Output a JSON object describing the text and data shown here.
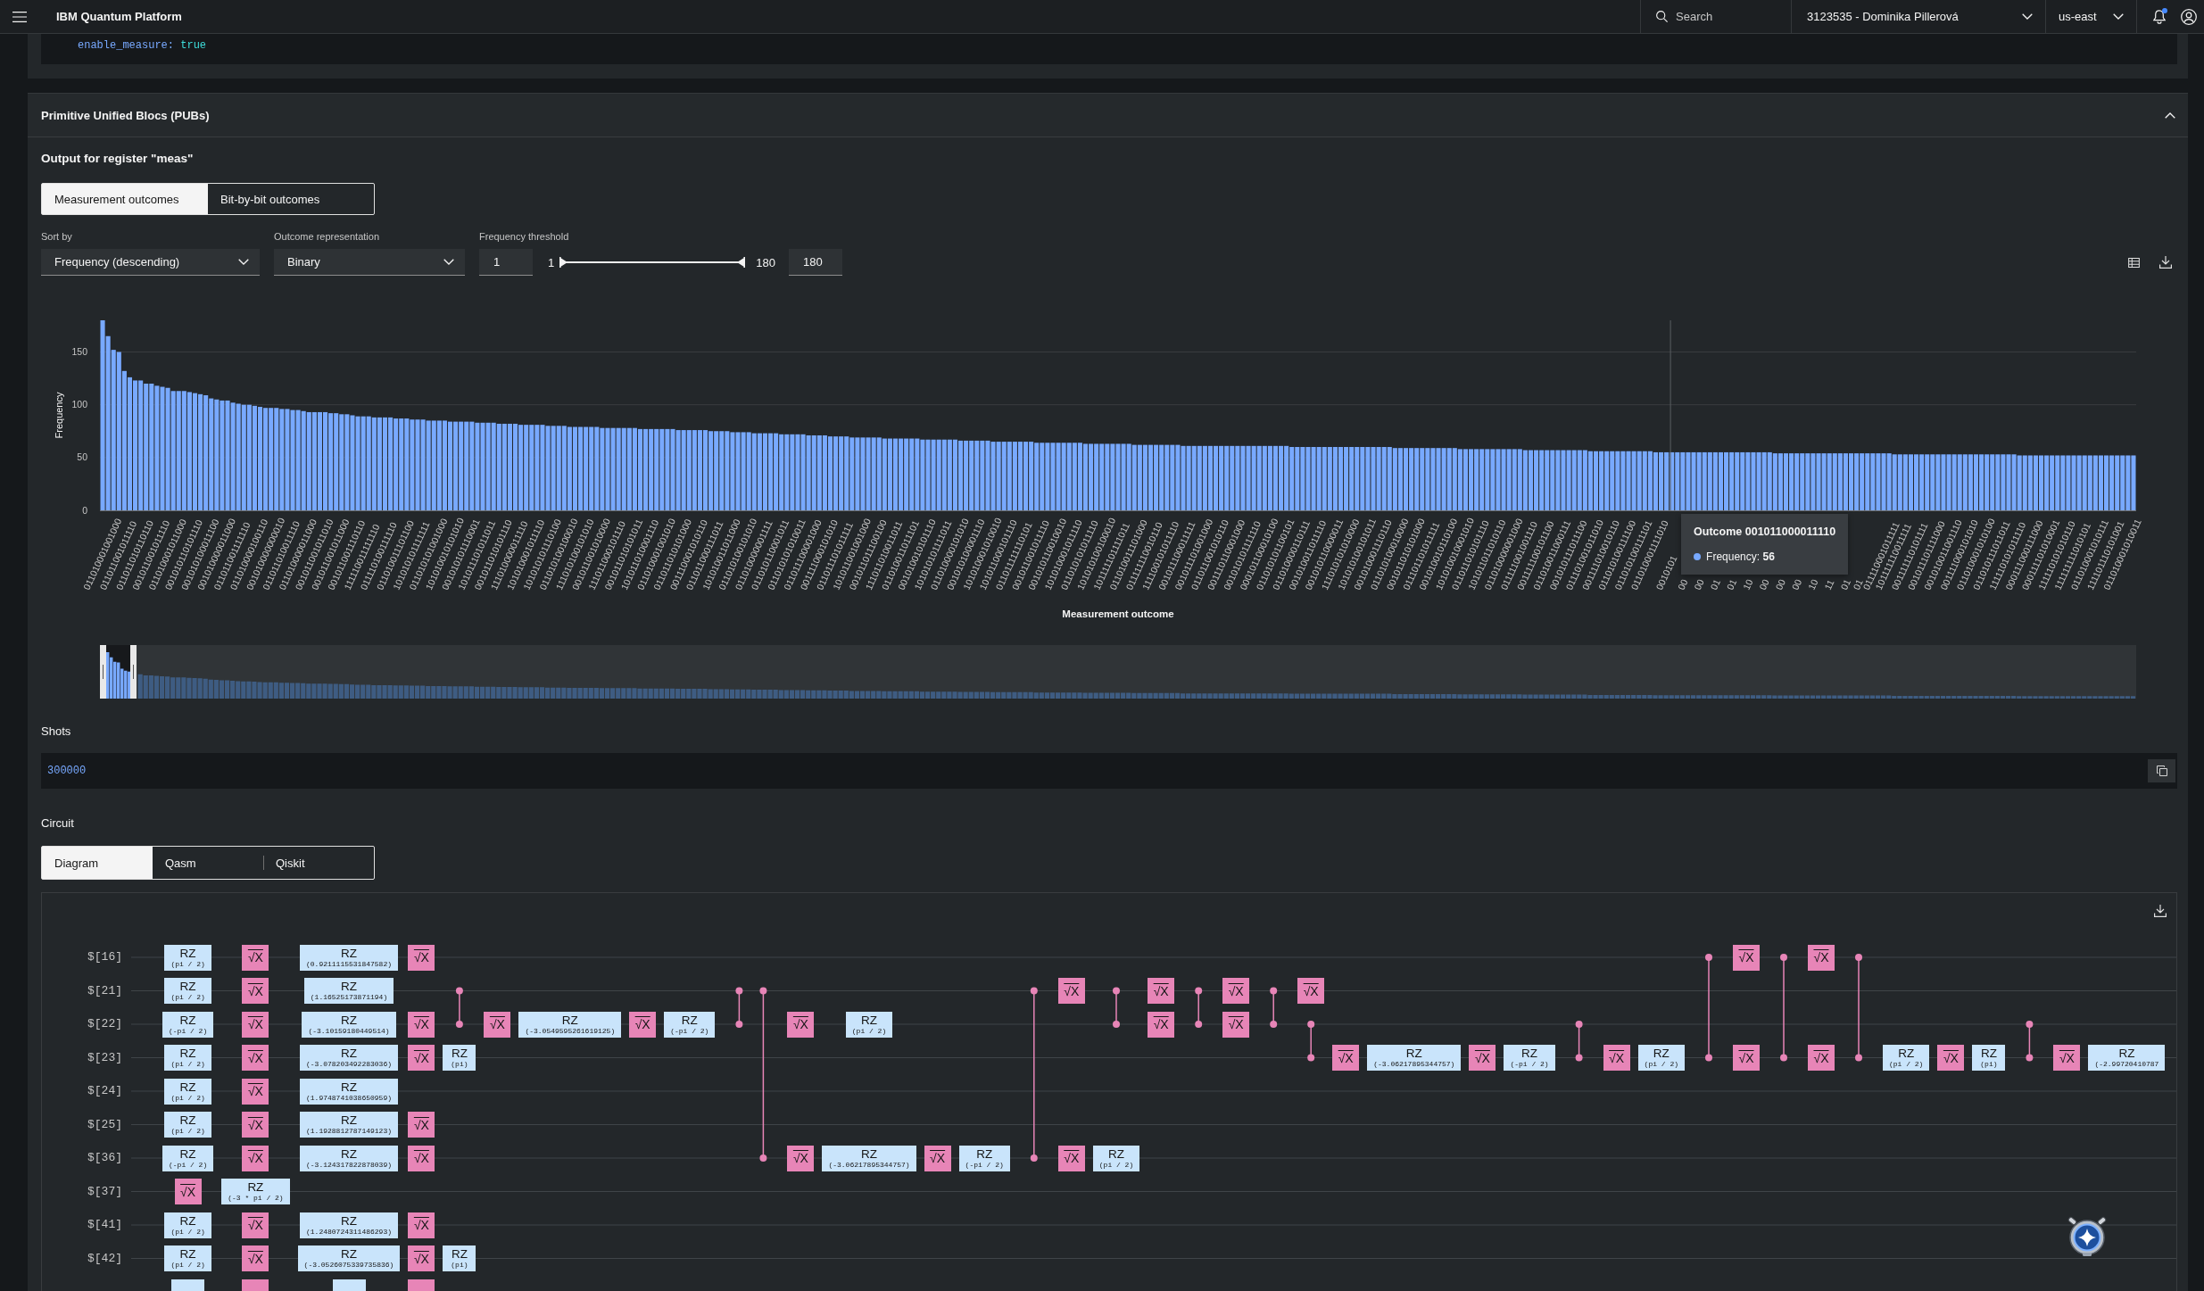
{
  "header": {
    "title": "IBM Quantum Platform",
    "search": {
      "placeholder": "Search"
    },
    "account": "3123535 - Dominika Pillerová",
    "region": "us-east",
    "notifications": {
      "unread": true
    }
  },
  "config_code": {
    "key": "enable_measure:",
    "value": "true"
  },
  "pubs": {
    "title": "Primitive Unified Blocs (PUBs)",
    "expanded": true,
    "output_title": "Output for register \"meas\"",
    "view_tabs": [
      {
        "label": "Measurement outcomes",
        "selected": true
      },
      {
        "label": "Bit-by-bit outcomes",
        "selected": false
      }
    ],
    "sort": {
      "label": "Sort by",
      "value": "Frequency (descending)"
    },
    "representation": {
      "label": "Outcome representation",
      "value": "Binary"
    },
    "threshold": {
      "label": "Frequency threshold",
      "min_value": "1",
      "min_label": "1",
      "max_label": "180",
      "max_value": "180",
      "thumbs": [
        {
          "level": 0
        },
        {
          "level": 1
        }
      ]
    },
    "chart_data": {
      "type": "bar",
      "xlabel": "Measurement outcome",
      "ylabel": "Frequency",
      "ylim": [
        0,
        180
      ],
      "yticks": [
        0,
        50,
        100,
        150
      ],
      "grid": true,
      "values": [
        180,
        165,
        152,
        150,
        132,
        126,
        123,
        123,
        120,
        120,
        118,
        117,
        116,
        113,
        113,
        113,
        112,
        111,
        110,
        109,
        106,
        105,
        104,
        104,
        102,
        101,
        100,
        100,
        99,
        98,
        97,
        97,
        97,
        96,
        96,
        95,
        95,
        94,
        93,
        93,
        93,
        93,
        92,
        92,
        91,
        91,
        90,
        89,
        89,
        89,
        88,
        88,
        88,
        88,
        87,
        87,
        87,
        86,
        86,
        86,
        85,
        85,
        85,
        85,
        84,
        84,
        84,
        84,
        84,
        83,
        83,
        83,
        83,
        82,
        82,
        82,
        82,
        81,
        81,
        81,
        81,
        81,
        80,
        80,
        80,
        80,
        79,
        79,
        79,
        79,
        79,
        79,
        78,
        78,
        78,
        78,
        78,
        78,
        78,
        77,
        77,
        77,
        77,
        77,
        77,
        77,
        76,
        76,
        76,
        76,
        76,
        76,
        75,
        75,
        75,
        75,
        74,
        74,
        74,
        74,
        73,
        73,
        73,
        73,
        73,
        72,
        72,
        72,
        72,
        72,
        71,
        71,
        71,
        71,
        70,
        70,
        70,
        70,
        69,
        69,
        69,
        69,
        69,
        69,
        68,
        68,
        68,
        68,
        68,
        68,
        68,
        67,
        67,
        67,
        67,
        67,
        67,
        67,
        66,
        66,
        66,
        66,
        66,
        66,
        65,
        65,
        65,
        65,
        65,
        65,
        65,
        65,
        64,
        64,
        64,
        64,
        64,
        64,
        64,
        64,
        64,
        63,
        63,
        63,
        63,
        63,
        63,
        63,
        63,
        63,
        62,
        62,
        62,
        62,
        62,
        62,
        62,
        62,
        62,
        61,
        61,
        61,
        61,
        61,
        61,
        61,
        61,
        61,
        61,
        61,
        61,
        61,
        61,
        61,
        61,
        61,
        61,
        61,
        61,
        60,
        60,
        60,
        60,
        60,
        60,
        60,
        60,
        60,
        60,
        60,
        60,
        60,
        60,
        60,
        60,
        60,
        60,
        60,
        59,
        59,
        59,
        59,
        59,
        59,
        59,
        59,
        59,
        59,
        59,
        59,
        58,
        58,
        58,
        58,
        58,
        58,
        58,
        58,
        58,
        58,
        58,
        58,
        57,
        57,
        57,
        57,
        57,
        57,
        57,
        57,
        57,
        57,
        57,
        57,
        56,
        56,
        56,
        56,
        56,
        56,
        56,
        56,
        56,
        56,
        56,
        56,
        55,
        55,
        55,
        55,
        55,
        55,
        55,
        55,
        55,
        55,
        55,
        55,
        55,
        55,
        55,
        55,
        55,
        55,
        55,
        55,
        55,
        55,
        54,
        54,
        54,
        54,
        54,
        54,
        54,
        54,
        54,
        54,
        54,
        54,
        54,
        54,
        54,
        54,
        54,
        54,
        54,
        54,
        54,
        54,
        53,
        53,
        53,
        53,
        53,
        53,
        53,
        53,
        53,
        53,
        53,
        53,
        53,
        53,
        53,
        53,
        53,
        53,
        53,
        53,
        53,
        53,
        53,
        52,
        52,
        52,
        52,
        52,
        52,
        52,
        52,
        52,
        52,
        52,
        52,
        52,
        52,
        52,
        52,
        52,
        52,
        52,
        52,
        52,
        52
      ],
      "categories": [
        "011010001001000",
        null,
        null,
        "011011001011110",
        null,
        null,
        "011011010110110",
        null,
        null,
        "001011001011110",
        null,
        null,
        "011010001011000",
        null,
        null,
        "001010110101110",
        null,
        null,
        "001010100011100",
        null,
        null,
        "001010000011000",
        null,
        null,
        "011011001111110",
        null,
        null,
        "011010000100110",
        null,
        null,
        "001010000000010",
        null,
        null,
        "011011010011110",
        null,
        null,
        "011010000011000",
        null,
        null,
        "001011001011010",
        null,
        null,
        "001011001011000",
        null,
        null,
        "001011001110110",
        null,
        null,
        "111110011111110",
        null,
        null,
        "011110100111110",
        null,
        null,
        "011010011101100",
        null,
        null,
        "101010101111111",
        null,
        null,
        "011010101001000",
        null,
        null,
        "101010010101010",
        null,
        null,
        "001010101110001",
        null,
        null,
        "101011101011011",
        null,
        null,
        "001011010101110",
        null,
        null,
        "111010000011110",
        null,
        null,
        "101010001011110",
        null,
        null,
        "101010101110100",
        null,
        null,
        "011010100100010",
        null,
        null,
        "111010100101010",
        null,
        null,
        "001011001010000",
        null,
        null,
        "111011000101110",
        null,
        null,
        "001011010101011",
        null,
        null,
        "101011010001110",
        null,
        null,
        "011010001001010",
        null,
        null,
        "011011010101000",
        null,
        null,
        "001110001010110",
        null,
        null,
        "011011000111011",
        null,
        null,
        "101010011011000",
        null,
        null,
        "011010100101010",
        null,
        null,
        "011010000001111",
        null,
        null,
        "011010110001011",
        null,
        null,
        "011010101010011",
        null,
        null,
        "011011100001000",
        null,
        null,
        "001111000101010",
        null,
        null,
        "011011101011111",
        null,
        null,
        "101011001001000",
        null,
        null,
        "001011011100100",
        null,
        null,
        "111011010011011",
        null,
        null,
        "011010011011101",
        null,
        null,
        "001010010101110",
        null,
        null,
        "101010101111011",
        null,
        null,
        "011010000101010",
        null,
        null,
        "001010100001110",
        null,
        null,
        "101010001010010",
        null,
        null,
        "101011000101110",
        null,
        null,
        "011011111110101",
        null,
        null,
        "001011001011110",
        null,
        null,
        "001010110010010",
        null,
        null,
        "101010001011110",
        null,
        null,
        "011010101011110",
        null,
        null,
        "101010100100010",
        null,
        null,
        "101111101111011",
        null,
        null,
        "011010011101000",
        null,
        null,
        "011111110010110",
        null,
        null,
        "111100101011110",
        null,
        null,
        "001011100011111",
        null,
        null,
        "001011101001000",
        null,
        null,
        "011011001010110",
        null,
        null,
        "001110110001000",
        null,
        null,
        "001010101111110",
        null,
        null,
        "000101100010100",
        null,
        null,
        "011010101100101",
        null,
        null,
        "011010000110111",
        null,
        null,
        "001010011011110",
        null,
        null,
        "001010110000011",
        null,
        null,
        "111010101010000",
        null,
        null,
        "101010100101011",
        null,
        null,
        "001010001110110",
        null,
        null,
        "011010100010000",
        null,
        null,
        "001011010101000",
        null,
        null,
        "011101101011111",
        null,
        null,
        "001010010110100",
        null,
        null,
        "101010010001010",
        null,
        null,
        "011011010101110",
        null,
        null,
        "101011011010110",
        null,
        null,
        "011010000001000",
        null,
        null,
        "011111001001110",
        null,
        null,
        "001111100101100",
        null,
        null,
        "011010011000111",
        null,
        null,
        "001010111011100",
        null,
        null,
        "011101001011010",
        null,
        null,
        "001111010010110",
        null,
        null,
        "011010100111100",
        null,
        null,
        "011010100111101",
        null,
        null,
        "011010001111010",
        null,
        null,
        "0010101",
        null,
        null,
        "00",
        null,
        null,
        "00",
        null,
        null,
        "01",
        null,
        null,
        "01",
        null,
        null,
        "10",
        null,
        null,
        "00",
        null,
        null,
        "00",
        null,
        null,
        "00",
        null,
        null,
        "10",
        null,
        null,
        "11",
        null,
        null,
        "01",
        null,
        null,
        "01",
        null,
        null,
        "011110001011111",
        null,
        null,
        "101111110011111",
        null,
        null,
        "001111110101111",
        null,
        null,
        "001011101111000",
        null,
        null,
        "001010011001110",
        null,
        null,
        "001111000101010",
        null,
        null,
        "011010001010100",
        null,
        null,
        "011010111011011",
        null,
        null,
        "111110101011110",
        null,
        null,
        "000111000111000",
        null,
        null,
        "000111101010001",
        null,
        null,
        "111110101010110",
        null,
        null,
        "111111111010101",
        null,
        null,
        "011010001010111",
        null,
        null,
        "111101110101001",
        null,
        null,
        "011010001010011",
        null,
        null
      ],
      "annotations": [
        "Outcome 001011000011110",
        "Frequency: **56**"
      ]
    },
    "zoom_bar": {
      "level": 0.018
    },
    "shots": {
      "label": "Shots",
      "value": "300000"
    },
    "circuit": {
      "label": "Circuit",
      "tabs": [
        {
          "label": "Diagram",
          "selected": true
        },
        {
          "label": "Qasm",
          "selected": false
        },
        {
          "label": "Qiskit",
          "selected": false
        }
      ],
      "qubits": [
        "$[16]",
        "$[21]",
        "$[22]",
        "$[23]",
        "$[24]",
        "$[25]",
        "$[36]",
        "$[37]",
        "$[41]",
        "$[42]"
      ],
      "layers": [
        [
          {
            "kind": "rz",
            "label": "RZ",
            "param": "(pi / 2)"
          },
          {
            "kind": "rz",
            "label": "RZ",
            "param": "(pi / 2)"
          },
          {
            "kind": "rz",
            "label": "RZ",
            "param": "(-pi / 2)"
          },
          {
            "kind": "rz",
            "label": "RZ",
            "param": "(pi / 2)"
          },
          {
            "kind": "rz",
            "label": "RZ",
            "param": "(pi / 2)"
          },
          {
            "kind": "rz",
            "label": "RZ",
            "param": "(pi / 2)"
          },
          {
            "kind": "rz",
            "label": "RZ",
            "param": "(-pi / 2)"
          },
          {
            "kind": "sx",
            "label": "√X"
          },
          {
            "kind": "rz",
            "label": "RZ",
            "param": "(pi / 2)"
          },
          {
            "kind": "rz",
            "label": "RZ",
            "param": "(pi / 2)"
          },
          {
            "kind": "rz"
          }
        ],
        [
          {
            "kind": "sx",
            "label": "√X"
          },
          {
            "kind": "sx",
            "label": "√X"
          },
          {
            "kind": "sx",
            "label": "√X"
          },
          {
            "kind": "sx",
            "label": "√X"
          },
          {
            "kind": "sx",
            "label": "√X"
          },
          {
            "kind": "sx",
            "label": "√X"
          },
          {
            "kind": "sx",
            "label": "√X"
          },
          {
            "kind": "rz",
            "label": "RZ",
            "param": "(-3 * pi / 2)"
          },
          {
            "kind": "sx",
            "label": "√X"
          },
          {
            "kind": "sx",
            "label": "√X"
          },
          {
            "kind": "sx"
          }
        ],
        [
          {
            "kind": "rz",
            "label": "RZ",
            "param": "(0.9211115531847582)"
          },
          {
            "kind": "rz",
            "label": "RZ",
            "param": "(1.16525173871194)"
          },
          {
            "kind": "rz",
            "label": "RZ",
            "param": "(-3.10159180449514)"
          },
          {
            "kind": "rz",
            "label": "RZ",
            "param": "(-3.078203492283036)"
          },
          {
            "kind": "rz",
            "label": "RZ",
            "param": "(1.9748741038650959)"
          },
          {
            "kind": "rz",
            "label": "RZ",
            "param": "(1.1928812787149123)"
          },
          {
            "kind": "rz",
            "label": "RZ",
            "param": "(-3.124317822878039)"
          },
          {
            "kind": "wire"
          },
          {
            "kind": "rz",
            "label": "RZ",
            "param": "(1.2480724311486293)"
          },
          {
            "kind": "rz",
            "label": "RZ",
            "param": "(-3.0526075339735836)"
          },
          {
            "kind": "rz"
          }
        ],
        [
          {
            "kind": "sx",
            "label": "√X"
          },
          {
            "kind": "wire"
          },
          {
            "kind": "sx",
            "label": "√X"
          },
          {
            "kind": "sx",
            "label": "√X"
          },
          {
            "kind": "wire"
          },
          {
            "kind": "sx",
            "label": "√X"
          },
          {
            "kind": "sx",
            "label": "√X"
          },
          {
            "kind": "wire"
          },
          {
            "kind": "sx",
            "label": "√X"
          },
          {
            "kind": "sx",
            "label": "√X"
          },
          {
            "kind": "sx"
          }
        ],
        [
          {
            "kind": "wire"
          },
          {
            "kind": "cz"
          },
          {
            "kind": "cz"
          },
          {
            "kind": "rz",
            "label": "RZ",
            "param": "(pi)"
          },
          {
            "kind": "wire"
          },
          {
            "kind": "wire"
          },
          {
            "kind": "wire"
          },
          {
            "kind": "wire"
          },
          {
            "kind": "wire"
          },
          {
            "kind": "rz",
            "label": "RZ",
            "param": "(pi)"
          }
        ],
        [
          {
            "kind": "wire"
          },
          {
            "kind": "wire"
          },
          {
            "kind": "sx",
            "label": "√X"
          }
        ],
        [
          {
            "kind": "wire"
          },
          {
            "kind": "wire"
          },
          {
            "kind": "rz",
            "label": "RZ",
            "param": "(-3.0549595261619125)"
          }
        ],
        [
          {
            "kind": "wire"
          },
          {
            "kind": "wire"
          },
          {
            "kind": "sx",
            "label": "√X"
          }
        ],
        [
          {
            "kind": "wire"
          },
          {
            "kind": "wire"
          },
          {
            "kind": "rz",
            "label": "RZ",
            "param": "(-pi / 2)"
          }
        ],
        [
          {
            "kind": "wire"
          },
          {
            "kind": "cz"
          },
          {
            "kind": "cz"
          }
        ],
        [
          {
            "kind": "wire"
          },
          {
            "kind": "cz"
          },
          {
            "kind": "wire"
          },
          {
            "kind": "wire"
          },
          {
            "kind": "wire"
          },
          {
            "kind": "wire"
          },
          {
            "kind": "cz"
          }
        ],
        [
          {
            "kind": "wire"
          },
          {
            "kind": "wire"
          },
          {
            "kind": "sx",
            "label": "√X"
          },
          {
            "kind": "wire"
          },
          {
            "kind": "wire"
          },
          {
            "kind": "wire"
          },
          {
            "kind": "sx",
            "label": "√X"
          }
        ],
        [
          {
            "kind": "wire"
          },
          {
            "kind": "wire"
          },
          {
            "kind": "rz",
            "label": "RZ",
            "param": "(pi / 2)"
          },
          {
            "kind": "wire"
          },
          {
            "kind": "wire"
          },
          {
            "kind": "wire"
          },
          {
            "kind": "rz",
            "label": "RZ",
            "param": "(-3.06217895344757)"
          }
        ],
        [
          {
            "kind": "wire"
          },
          {
            "kind": "wire"
          },
          {
            "kind": "wire"
          },
          {
            "kind": "wire"
          },
          {
            "kind": "wire"
          },
          {
            "kind": "wire"
          },
          {
            "kind": "sx",
            "label": "√X"
          }
        ],
        [
          {
            "kind": "wire"
          },
          {
            "kind": "wire"
          },
          {
            "kind": "wire"
          },
          {
            "kind": "wire"
          },
          {
            "kind": "wire"
          },
          {
            "kind": "wire"
          },
          {
            "kind": "rz",
            "label": "RZ",
            "param": "(-pi / 2)"
          }
        ],
        [
          {
            "kind": "wire"
          },
          {
            "kind": "cz"
          },
          {
            "kind": "wire"
          },
          {
            "kind": "wire"
          },
          {
            "kind": "wire"
          },
          {
            "kind": "wire"
          },
          {
            "kind": "cz"
          }
        ],
        [
          {
            "kind": "wire"
          },
          {
            "kind": "sx",
            "label": "√X"
          },
          {
            "kind": "wire"
          },
          {
            "kind": "wire"
          },
          {
            "kind": "wire"
          },
          {
            "kind": "wire"
          },
          {
            "kind": "sx",
            "label": "√X"
          }
        ],
        [
          {
            "kind": "wire"
          },
          {
            "kind": "cz"
          },
          {
            "kind": "cz"
          },
          {
            "kind": "wire"
          },
          {
            "kind": "wire"
          },
          {
            "kind": "wire"
          },
          {
            "kind": "rz",
            "label": "RZ",
            "param": "(pi / 2)"
          }
        ],
        [
          {
            "kind": "wire"
          },
          {
            "kind": "sx",
            "label": "√X"
          },
          {
            "kind": "sx",
            "label": "√X"
          }
        ],
        [
          {
            "kind": "wire"
          },
          {
            "kind": "cz"
          },
          {
            "kind": "cz"
          }
        ],
        [
          {
            "kind": "wire"
          },
          {
            "kind": "sx",
            "label": "√X"
          },
          {
            "kind": "sx",
            "label": "√X"
          }
        ],
        [
          {
            "kind": "wire"
          },
          {
            "kind": "cz"
          },
          {
            "kind": "cz"
          }
        ],
        [
          {
            "kind": "wire"
          },
          {
            "kind": "sx",
            "label": "√X"
          },
          {
            "kind": "cz"
          },
          {
            "kind": "cz"
          }
        ],
        [
          {
            "kind": "wire"
          },
          {
            "kind": "wire"
          },
          {
            "kind": "wire"
          },
          {
            "kind": "sx",
            "label": "√X"
          }
        ],
        [
          {
            "kind": "wire"
          },
          {
            "kind": "wire"
          },
          {
            "kind": "wire"
          },
          {
            "kind": "rz",
            "label": "RZ",
            "param": "(-3.06217895344757)"
          }
        ],
        [
          {
            "kind": "wire"
          },
          {
            "kind": "wire"
          },
          {
            "kind": "wire"
          },
          {
            "kind": "sx",
            "label": "√X"
          }
        ],
        [
          {
            "kind": "wire"
          },
          {
            "kind": "wire"
          },
          {
            "kind": "wire"
          },
          {
            "kind": "rz",
            "label": "RZ",
            "param": "(-pi / 2)"
          }
        ],
        [
          {
            "kind": "wire"
          },
          {
            "kind": "wire"
          },
          {
            "kind": "cz"
          },
          {
            "kind": "cz"
          }
        ],
        [
          {
            "kind": "wire"
          },
          {
            "kind": "wire"
          },
          {
            "kind": "wire"
          },
          {
            "kind": "sx",
            "label": "√X"
          }
        ],
        [
          {
            "kind": "wire"
          },
          {
            "kind": "wire"
          },
          {
            "kind": "wire"
          },
          {
            "kind": "rz",
            "label": "RZ",
            "param": "(pi / 2)"
          }
        ],
        [
          {
            "kind": "cz"
          },
          {
            "kind": "wire"
          },
          {
            "kind": "wire"
          },
          {
            "kind": "cz"
          }
        ],
        [
          {
            "kind": "sx",
            "label": "√X"
          },
          {
            "kind": "wire"
          },
          {
            "kind": "wire"
          },
          {
            "kind": "sx",
            "label": "√X"
          }
        ],
        [
          {
            "kind": "cz"
          },
          {
            "kind": "wire"
          },
          {
            "kind": "wire"
          },
          {
            "kind": "cz"
          }
        ],
        [
          {
            "kind": "sx",
            "label": "√X"
          },
          {
            "kind": "wire"
          },
          {
            "kind": "wire"
          },
          {
            "kind": "sx",
            "label": "√X"
          }
        ],
        [
          {
            "kind": "cz"
          },
          {
            "kind": "wire"
          },
          {
            "kind": "wire"
          },
          {
            "kind": "cz"
          }
        ],
        [
          {
            "kind": "wire"
          },
          {
            "kind": "wire"
          },
          {
            "kind": "wire"
          },
          {
            "kind": "rz",
            "label": "RZ",
            "param": "(pi / 2)"
          }
        ],
        [
          {
            "kind": "wire"
          },
          {
            "kind": "wire"
          },
          {
            "kind": "wire"
          },
          {
            "kind": "sx",
            "label": "√X"
          }
        ],
        [
          {
            "kind": "wire"
          },
          {
            "kind": "wire"
          },
          {
            "kind": "wire"
          },
          {
            "kind": "rz",
            "label": "RZ",
            "param": "(pi)"
          }
        ],
        [
          {
            "kind": "wire"
          },
          {
            "kind": "wire"
          },
          {
            "kind": "cz"
          },
          {
            "kind": "cz"
          }
        ],
        [
          {
            "kind": "wire"
          },
          {
            "kind": "wire"
          },
          {
            "kind": "wire"
          },
          {
            "kind": "sx",
            "label": "√X"
          }
        ],
        [
          {
            "kind": "wire"
          },
          {
            "kind": "wire"
          },
          {
            "kind": "wire"
          },
          {
            "kind": "rz",
            "label": "RZ",
            "param": "(-2.99720410787"
          }
        ]
      ]
    }
  }
}
